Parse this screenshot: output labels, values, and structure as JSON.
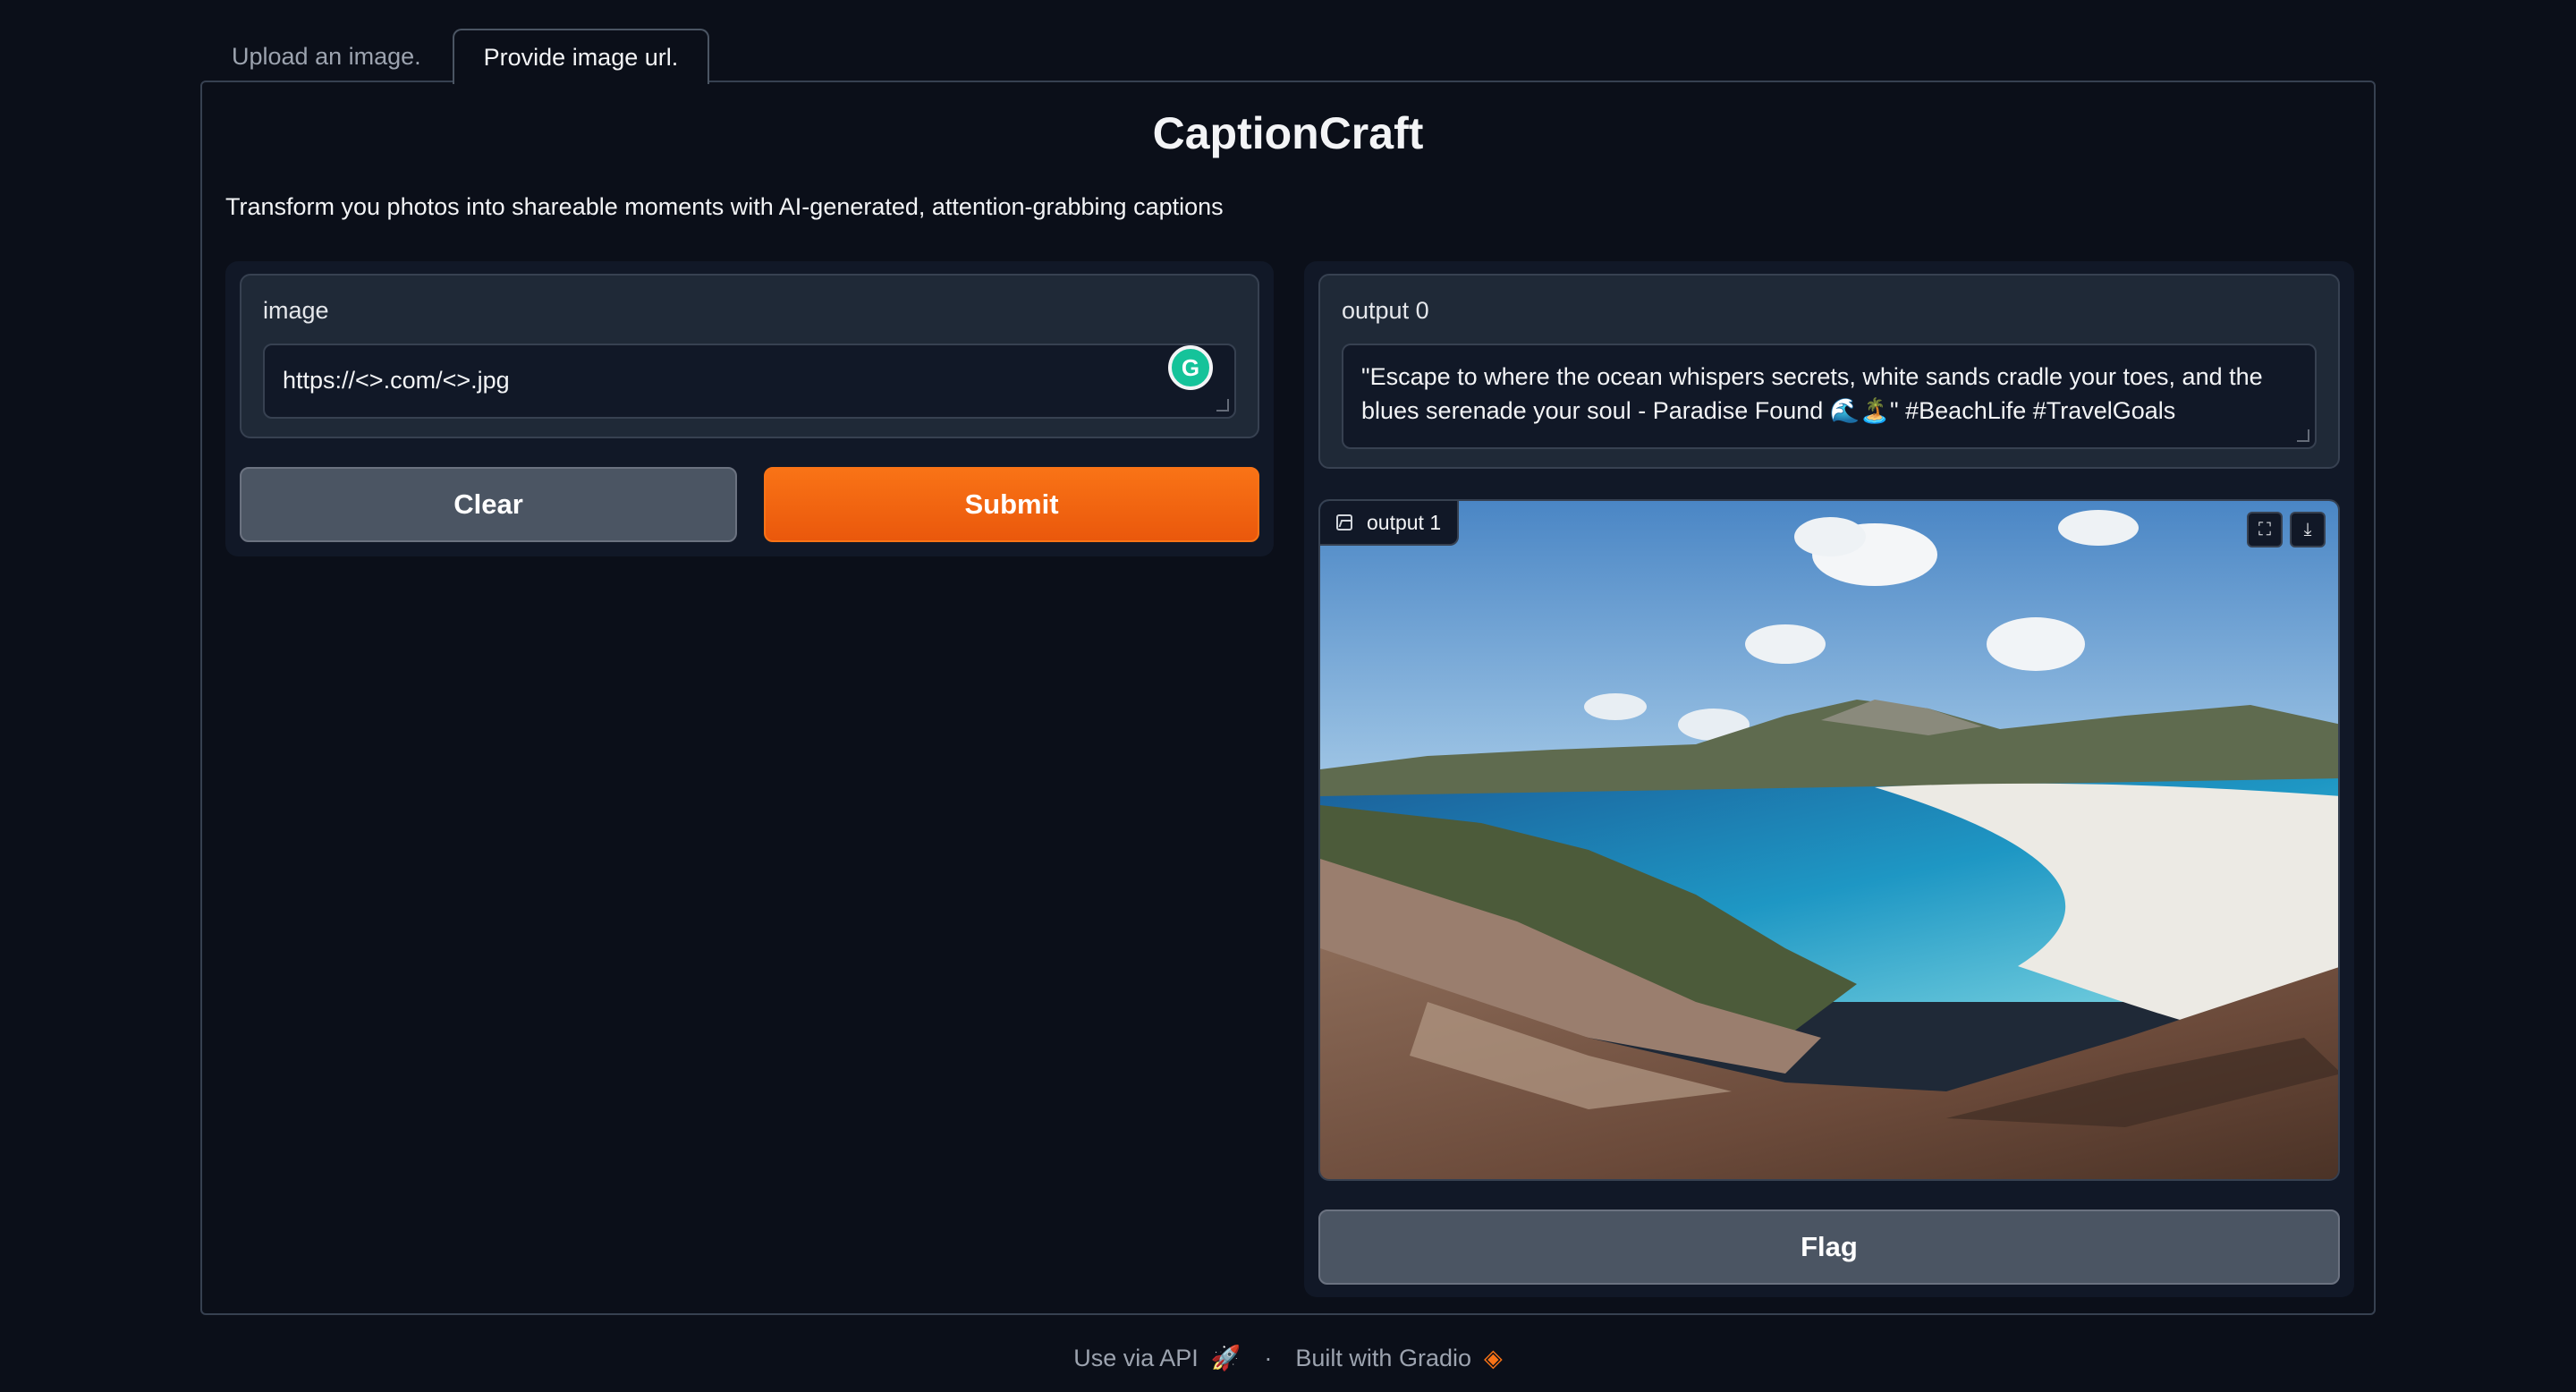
{
  "tabs": [
    {
      "label": "Upload an image.",
      "active": false
    },
    {
      "label": "Provide image url.",
      "active": true
    }
  ],
  "app": {
    "title": "CaptionCraft",
    "description": "Transform you photos into shareable moments with AI-generated, attention-grabbing captions"
  },
  "input": {
    "label": "image",
    "value": "https://<>.com/<>.jpg"
  },
  "buttons": {
    "clear": "Clear",
    "submit": "Submit",
    "flag": "Flag"
  },
  "output0": {
    "label": "output 0",
    "value": "\"Escape to where the ocean whispers secrets, white sands cradle your toes, and the blues serenade your soul - Paradise Found 🌊🏝️\" #BeachLife #TravelGoals"
  },
  "output1": {
    "label": "output 1"
  },
  "footer": {
    "api": "Use via API",
    "built": "Built with Gradio"
  },
  "colors": {
    "background": "#0b0f19",
    "accent": "#f97316",
    "panel": "#1f2937"
  }
}
